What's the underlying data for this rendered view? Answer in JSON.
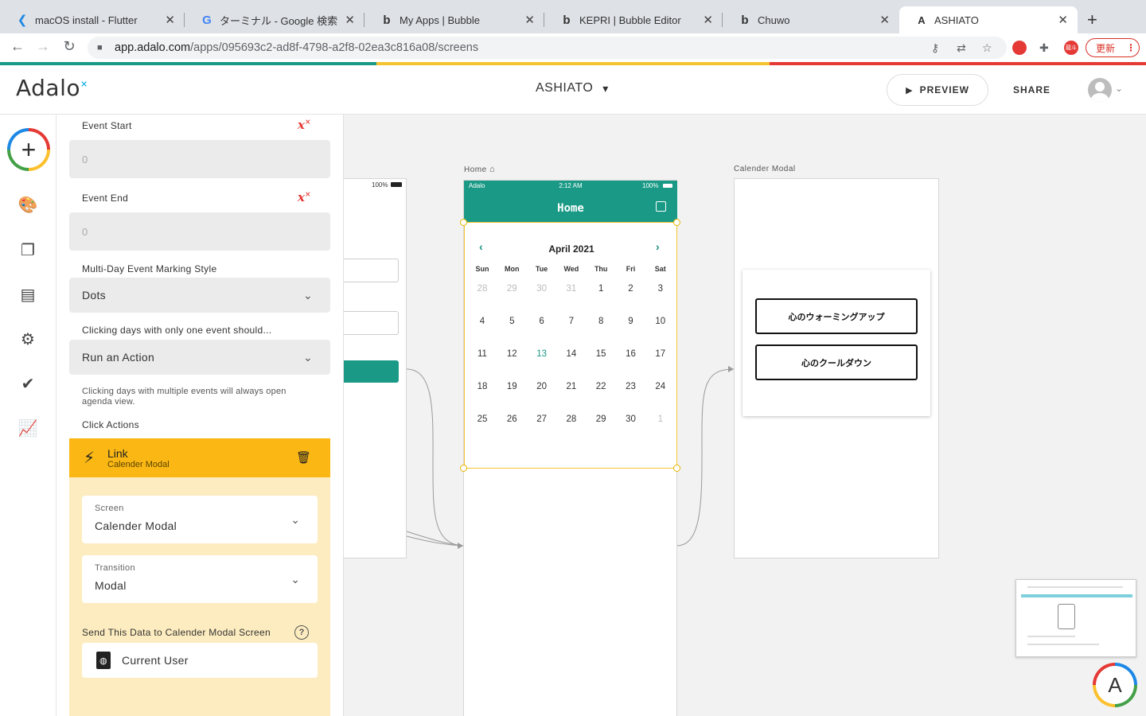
{
  "browser": {
    "tabs": [
      {
        "icon": "flutter-icon",
        "title": "macOS install - Flutter"
      },
      {
        "icon": "google-icon",
        "title": "ターミナル - Google 検索"
      },
      {
        "icon": "bubble-icon",
        "title": "My Apps | Bubble"
      },
      {
        "icon": "bubble-icon",
        "title": "KEPRI | Bubble Editor"
      },
      {
        "icon": "bubble-icon",
        "title": "Chuwo"
      },
      {
        "icon": "adalo-icon",
        "title": "ASHIATO"
      }
    ],
    "url_host": "app.adalo.com",
    "url_path": "/apps/095693c2-ad8f-4798-a2f8-02ea3c816a08/screens",
    "update_label": "更新",
    "extension_label": "龍斗",
    "accent_colors": [
      "#1a9a86",
      "#f4c430",
      "#e53935"
    ]
  },
  "header": {
    "logo": "Adalo",
    "app_name": "ASHIATO",
    "preview_label": "PREVIEW",
    "share_label": "SHARE"
  },
  "rail": {
    "icons": [
      "add-icon",
      "palette-icon",
      "screens-icon",
      "database-icon",
      "gear-icon",
      "publish-icon",
      "analytics-icon"
    ]
  },
  "panel": {
    "event_start": {
      "label": "Event Start",
      "value": "0"
    },
    "event_end": {
      "label": "Event End",
      "value": "0"
    },
    "marking_style": {
      "label": "Multi-Day Event Marking Style",
      "value": "Dots"
    },
    "one_event": {
      "label": "Clicking days with only one event should...",
      "value": "Run an Action"
    },
    "multi_note": "Clicking days with multiple events will always open agenda view.",
    "click_actions_label": "Click Actions",
    "action": {
      "title": "Link",
      "subtitle": "Calender Modal",
      "screen": {
        "label": "Screen",
        "value": "Calender Modal"
      },
      "transition": {
        "label": "Transition",
        "value": "Modal"
      },
      "send_label": "Send This Data to Calender Modal Screen",
      "send_value": "Current User"
    }
  },
  "canvas": {
    "left_screen_status": "100%",
    "home": {
      "label": "Home",
      "status_carrier": "Adalo",
      "status_time": "2:12 AM",
      "status_battery": "100%",
      "title": "Home",
      "calendar": {
        "month": "April 2021",
        "weekdays": [
          "Sun",
          "Mon",
          "Tue",
          "Wed",
          "Thu",
          "Fri",
          "Sat"
        ],
        "weeks": [
          [
            "28",
            "29",
            "30",
            "31",
            "1",
            "2",
            "3"
          ],
          [
            "4",
            "5",
            "6",
            "7",
            "8",
            "9",
            "10"
          ],
          [
            "11",
            "12",
            "13",
            "14",
            "15",
            "16",
            "17"
          ],
          [
            "18",
            "19",
            "20",
            "21",
            "22",
            "23",
            "24"
          ],
          [
            "25",
            "26",
            "27",
            "28",
            "29",
            "30",
            "1"
          ]
        ],
        "today": "13"
      }
    },
    "modal_screen": {
      "label": "Calender Modal",
      "button1": "心のウォーミングアップ",
      "button2": "心のクールダウン"
    }
  }
}
